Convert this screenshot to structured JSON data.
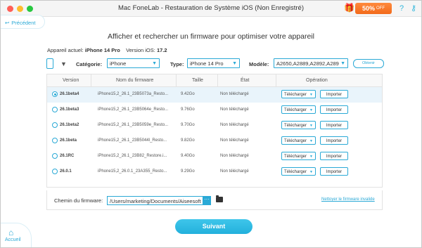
{
  "window": {
    "title": "Mac FoneLab - Restauration de Système iOS (Non Enregistré)"
  },
  "promo": {
    "value": "50%",
    "suffix": "OFF"
  },
  "back_label": "Précédent",
  "headline": "Afficher et rechercher un firmware pour optimiser votre appareil",
  "device": {
    "label": "Appareil actuel:",
    "name": "iPhone 14 Pro",
    "version_label": "Version iOS:",
    "version": "17.2"
  },
  "filters": {
    "category_label": "Catégorie:",
    "category_value": "iPhone",
    "type_label": "Type:",
    "type_value": "iPhone 14 Pro",
    "model_label": "Modèle:",
    "model_value": "A2650,A2889,A2892,A289",
    "obtain_label": "Obtenir"
  },
  "table": {
    "headers": [
      "Version",
      "Nom du firmware",
      "Taille",
      "État",
      "Opération"
    ],
    "download_label": "Télécharger",
    "import_label": "Importer",
    "rows": [
      {
        "version": "26.1beta4",
        "name": "iPhone15,2_26.1_23B5073a_Resto...",
        "size": "9.42Go",
        "state": "Non téléchargé",
        "selected": true
      },
      {
        "version": "26.1beta3",
        "name": "iPhone15,2_26.1_23B5064e_Resto...",
        "size": "9.76Go",
        "state": "Non téléchargé",
        "selected": false
      },
      {
        "version": "26.1beta2",
        "name": "iPhone15,2_26.1_23B5059e_Resto...",
        "size": "9.70Go",
        "state": "Non téléchargé",
        "selected": false
      },
      {
        "version": "26.1beta",
        "name": "iPhone15,2_26.1_23B5044l_Resto...",
        "size": "9.82Go",
        "state": "Non téléchargé",
        "selected": false
      },
      {
        "version": "26.1RC",
        "name": "iPhone15,2_26.1_23B82_Restore.i...",
        "size": "9.40Go",
        "state": "Non téléchargé",
        "selected": false
      },
      {
        "version": "26.0.1",
        "name": "iPhone15,2_26.0.1_23A355_Resto...",
        "size": "9.29Go",
        "state": "Non téléchargé",
        "selected": false
      }
    ]
  },
  "path": {
    "label": "Chemin du firmware:",
    "value": "/Users/marketing/Documents/Aiseesoft",
    "browse": "···",
    "clean_link": "Nettoyer le firmware invalide"
  },
  "next_label": "Suivant",
  "home_label": "Accueil"
}
